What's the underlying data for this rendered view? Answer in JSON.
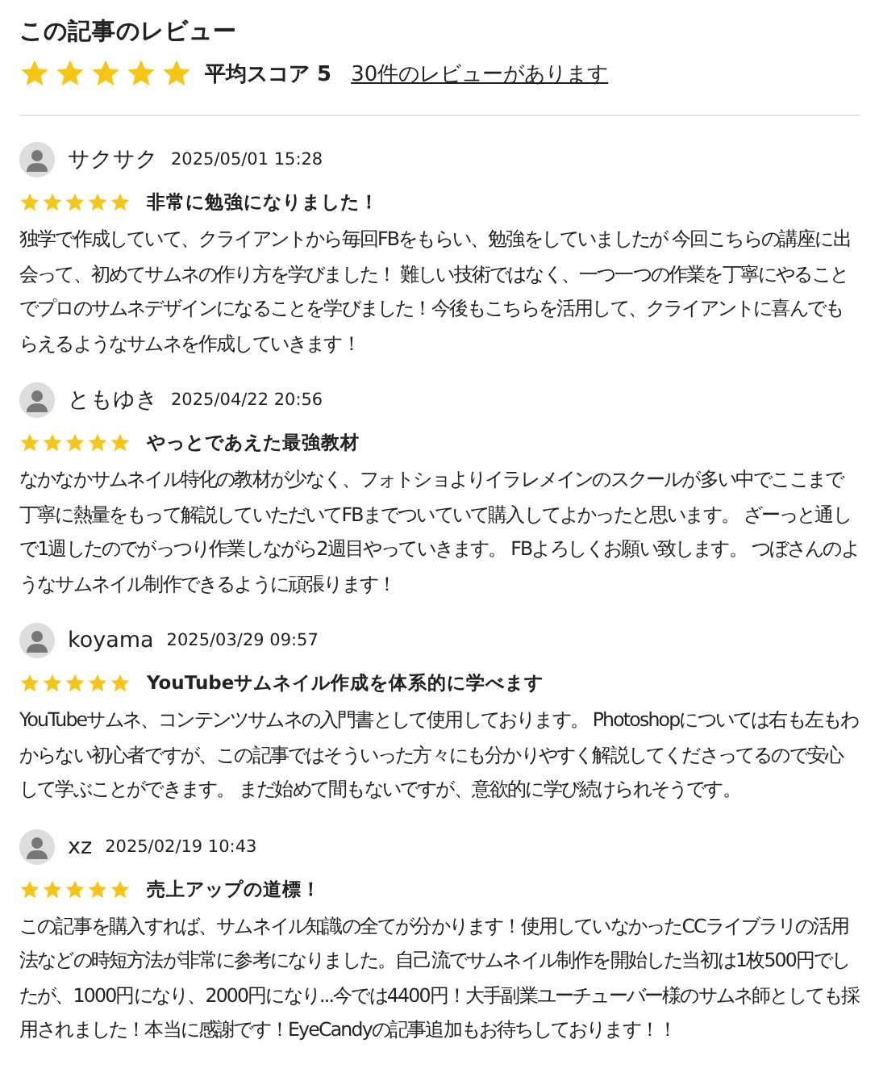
{
  "header": {
    "title": "この記事のレビュー",
    "stars": 5,
    "average": "平均スコア 5",
    "review_count_link": "30件のレビューがあります"
  },
  "reviews": [
    {
      "name": "サクサク",
      "date": "2025/05/01 15:28",
      "stars": 5,
      "title": "非常に勉強になりました！",
      "body": "独学で作成していて、クライアントから毎回FBをもらい、勉強をしていましたが 今回こちらの講座に出会って、初めてサムネの作り方を学びました！ 難しい技術ではなく、一つ一つの作業を丁寧にやることでプロのサムネデザインになることを学びました！今後もこちらを活用して、クライアントに喜んでもらえるようなサムネを作成していきます！"
    },
    {
      "name": "ともゆき",
      "date": "2025/04/22 20:56",
      "stars": 5,
      "title": "やっとであえた最強教材",
      "body": "なかなかサムネイル特化の教材が少なく、フォトショよりイラレメインのスクールが多い中でここまで丁寧に熱量をもって解説していただいてFBまでついていて購入してよかったと思います。 ざーっと通しで1週したのでがっつり作業しながら2週目やっていきます。 FBよろしくお願い致します。 つぼさんのようなサムネイル制作できるように頑張ります！"
    },
    {
      "name": "koyama",
      "date": "2025/03/29 09:57",
      "stars": 5,
      "title": "YouTubeサムネイル作成を体系的に学べます",
      "body": "YouTubeサムネ、コンテンツサムネの入門書として使用しております。 Photoshopについては右も左もわからない初心者ですが、この記事ではそういった方々にも分かりやすく解説してくださってるので安心して学ぶことができます。 まだ始めて間もないですが、意欲的に学び続けられそうです。"
    },
    {
      "name": "xz",
      "date": "2025/02/19 10:43",
      "stars": 5,
      "title": "売上アップの道標！",
      "body": "この記事を購入すれば、サムネイル知識の全てが分かります！使用していなかったCCライブラリの活用法などの時短方法が非常に参考になりました。自己流でサムネイル制作を開始した当初は1枚500円でしたが、1000円になり、2000円になり...今では4400円！大手副業ユーチューバー様のサムネ師としても採用されました！本当に感謝です！EyeCandyの記事追加もお待ちしております！！"
    }
  ]
}
